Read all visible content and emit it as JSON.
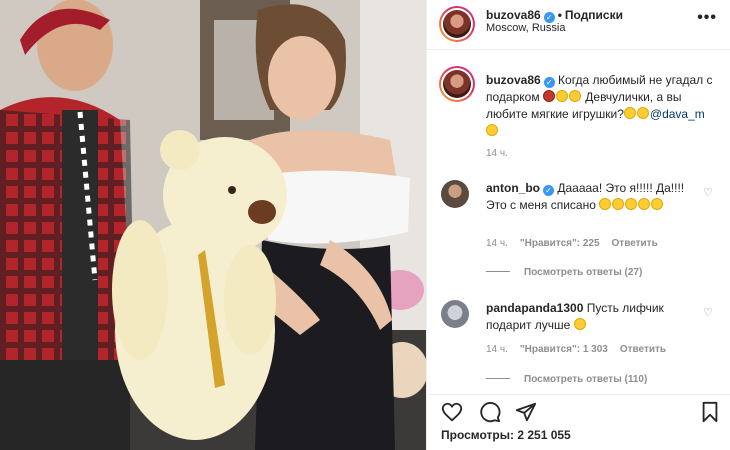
{
  "post": {
    "username": "buzova86",
    "follow_label": "Подписки",
    "location": "Moscow, Russia",
    "more_label": "•••"
  },
  "caption": {
    "username": "buzova86",
    "text_line1": "Когда любимый не угадал с подарком",
    "text_line2": "Девчулички, а вы любите мягкие игрушки?",
    "mention": "@dava_m",
    "time": "14 ч."
  },
  "comments": [
    {
      "username": "anton_bo",
      "text": "Дааааа! Это я!!!!! Да!!!! Это с меня списано",
      "time": "14 ч.",
      "likes": "\"Нравится\": 225",
      "reply_label": "Ответить",
      "view_replies": "Посмотреть ответы (27)"
    },
    {
      "username": "pandapanda1300",
      "text": "Пусть лифчик подарит лучше",
      "time": "14 ч.",
      "likes": "\"Нравится\": 1 303",
      "reply_label": "Ответить",
      "view_replies": "Посмотреть ответы (110)"
    }
  ],
  "views": "Просмотры: 2 251 055",
  "icons": [
    "heart-icon",
    "comment-icon",
    "share-icon",
    "bookmark-icon",
    "verified-icon",
    "more-icon"
  ],
  "colors": {
    "verified": "#3897f0",
    "muted": "#8e8e8e",
    "text": "#262626"
  }
}
